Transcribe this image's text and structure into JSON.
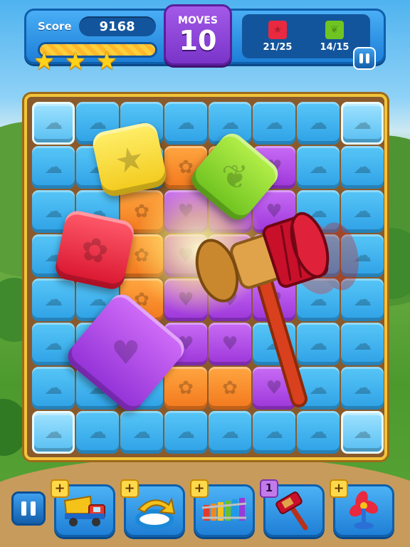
{
  "hud": {
    "score_label": "Score",
    "score_value": "9168",
    "progress_fraction": 1.0,
    "stars": [
      "star-icon",
      "star-icon",
      "star-icon"
    ],
    "moves_label": "MOVES",
    "moves_value": "10",
    "goals": [
      {
        "icon": "red-star-block-icon",
        "color": "#e8293f",
        "count": "21/25"
      },
      {
        "icon": "green-leaf-block-icon",
        "color": "#6fc422",
        "count": "14/15"
      }
    ]
  },
  "board": {
    "rows": [
      [
        "glass",
        "blue",
        "blue",
        "blue",
        "blue",
        "blue",
        "blue",
        "glass"
      ],
      [
        "blue",
        "blue",
        "blue",
        "orange",
        "orange",
        "purple",
        "blue",
        "blue"
      ],
      [
        "blue",
        "blue",
        "orange",
        "purple",
        "purple",
        "purple",
        "blue",
        "blue"
      ],
      [
        "blue",
        "blue",
        "orange",
        "purple",
        "purple",
        "purple",
        "blue",
        "blue"
      ],
      [
        "blue",
        "blue",
        "orange",
        "purple",
        "purple",
        "purple",
        "blue",
        "blue"
      ],
      [
        "blue",
        "blue",
        "blue",
        "purple",
        "purple",
        "blue",
        "blue",
        "blue"
      ],
      [
        "blue",
        "blue",
        "blue",
        "orange",
        "orange",
        "purple",
        "blue",
        "blue"
      ],
      [
        "glass",
        "blue",
        "blue",
        "blue",
        "blue",
        "blue",
        "blue",
        "glass"
      ]
    ],
    "symbols": {
      "blue": "☁",
      "purple": "♥",
      "orange": "✿",
      "glass": "☁"
    },
    "flying_blocks": [
      {
        "name": "yellow-star-block",
        "symbol": "★"
      },
      {
        "name": "green-leaf-block",
        "symbol": "❦"
      },
      {
        "name": "red-flower-block",
        "symbol": "✿"
      },
      {
        "name": "purple-heart-block",
        "symbol": "♥"
      }
    ]
  },
  "boosters": [
    {
      "name": "dump-truck",
      "count": "+"
    },
    {
      "name": "swap-arrow",
      "count": "+"
    },
    {
      "name": "xylophone",
      "count": "+"
    },
    {
      "name": "hammer",
      "count": "1"
    },
    {
      "name": "fan",
      "count": "+"
    }
  ]
}
